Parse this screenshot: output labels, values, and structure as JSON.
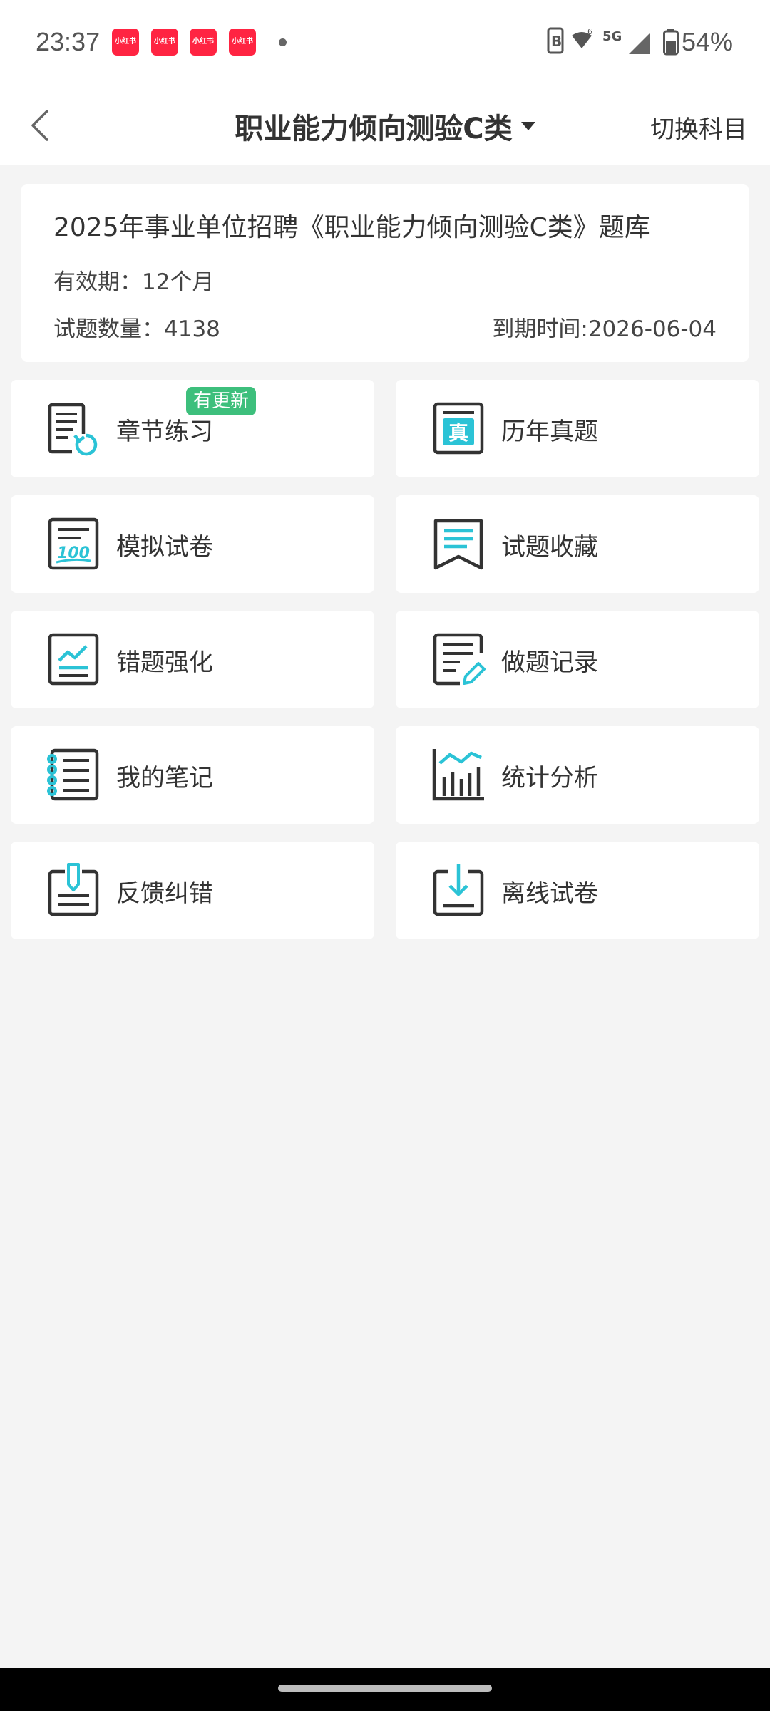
{
  "status": {
    "time": "23:37",
    "notifications": [
      "小红书",
      "小红书",
      "小红书",
      "小红书"
    ],
    "network": "5G",
    "battery": "54%"
  },
  "header": {
    "title": "职业能力倾向测验C类",
    "switch_label": "切换科目"
  },
  "info": {
    "title": "2025年事业单位招聘《职业能力倾向测验C类》题库",
    "validity": "有效期：12个月",
    "count": "试题数量：4138",
    "expire": "到期时间:2026-06-04"
  },
  "menu": [
    {
      "label": "章节练习",
      "icon": "chapter-practice-icon",
      "badge": "有更新"
    },
    {
      "label": "历年真题",
      "icon": "past-exams-icon"
    },
    {
      "label": "模拟试卷",
      "icon": "mock-exam-icon"
    },
    {
      "label": "试题收藏",
      "icon": "favorites-icon"
    },
    {
      "label": "错题强化",
      "icon": "wrong-questions-icon"
    },
    {
      "label": "做题记录",
      "icon": "practice-record-icon"
    },
    {
      "label": "我的笔记",
      "icon": "notes-icon"
    },
    {
      "label": "统计分析",
      "icon": "statistics-icon"
    },
    {
      "label": "反馈纠错",
      "icon": "feedback-icon"
    },
    {
      "label": "离线试卷",
      "icon": "offline-download-icon"
    }
  ],
  "icon_text": {
    "past_exams": "真",
    "mock_exam": "100"
  },
  "colors": {
    "accent": "#2bc3d6",
    "icon_stroke": "#333333",
    "badge": "#3dbf7c",
    "notification": "#ff2442"
  }
}
